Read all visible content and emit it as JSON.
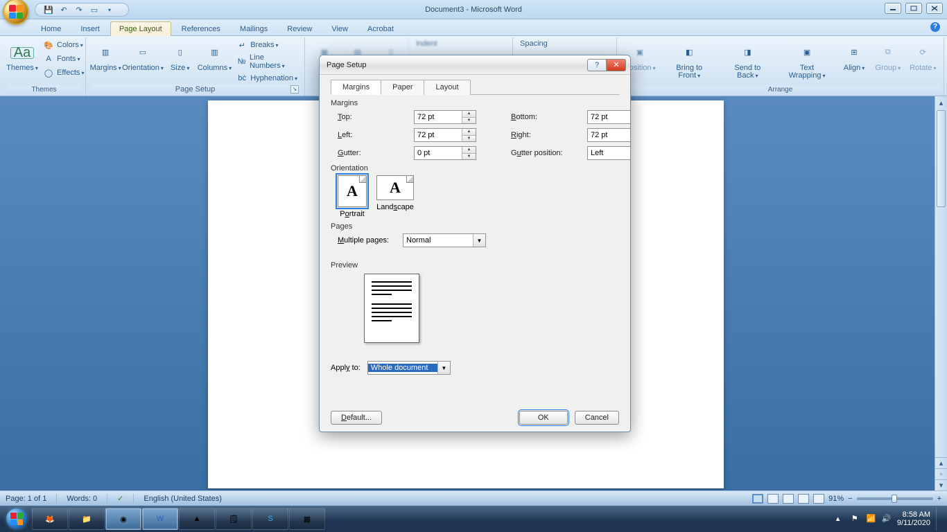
{
  "app": {
    "title": "Document3 - Microsoft Word"
  },
  "tabs": {
    "t0": "Home",
    "t1": "Insert",
    "t2": "Page Layout",
    "t3": "References",
    "t4": "Mailings",
    "t5": "Review",
    "t6": "View",
    "t7": "Acrobat"
  },
  "ribbon": {
    "themes": {
      "group": "Themes",
      "themes": "Themes",
      "colors": "Colors",
      "fonts": "Fonts",
      "effects": "Effects"
    },
    "pagesetup": {
      "group": "Page Setup",
      "margins": "Margins",
      "orientation": "Orientation",
      "size": "Size",
      "columns": "Columns",
      "breaks": "Breaks",
      "linenums": "Line Numbers",
      "hyphen": "Hyphenation"
    },
    "indent": "Indent",
    "spacing": "Spacing",
    "arrange": {
      "group": "Arrange",
      "position": "Position",
      "bringfront": "Bring to Front",
      "sendback": "Send to Back",
      "wrap": "Text Wrapping",
      "align": "Align",
      "group2": "Group",
      "rotate": "Rotate"
    }
  },
  "dialog": {
    "title": "Page Setup",
    "tabs": {
      "margins": "Margins",
      "paper": "Paper",
      "layout": "Layout"
    },
    "sect": {
      "margins": "Margins",
      "orientation": "Orientation",
      "pages": "Pages",
      "preview": "Preview"
    },
    "fields": {
      "top": "Top:",
      "bottom": "Bottom:",
      "left": "Left:",
      "right": "Right:",
      "gutter": "Gutter:",
      "gutterpos": "Gutter position:",
      "top_v": "72 pt",
      "bottom_v": "72 pt",
      "left_v": "72 pt",
      "right_v": "72 pt",
      "gutter_v": "0 pt",
      "gutterpos_v": "Left",
      "portrait": "Portrait",
      "landscape": "Landscape",
      "multpages": "Multiple pages:",
      "multpages_v": "Normal",
      "applyto": "Apply to:",
      "applyto_v": "Whole document"
    },
    "buttons": {
      "default": "Default...",
      "ok": "OK",
      "cancel": "Cancel"
    }
  },
  "status": {
    "page": "Page: 1 of 1",
    "words": "Words: 0",
    "lang": "English (United States)",
    "zoom": "91%"
  },
  "tray": {
    "time": "8:58 AM",
    "date": "9/11/2020"
  }
}
